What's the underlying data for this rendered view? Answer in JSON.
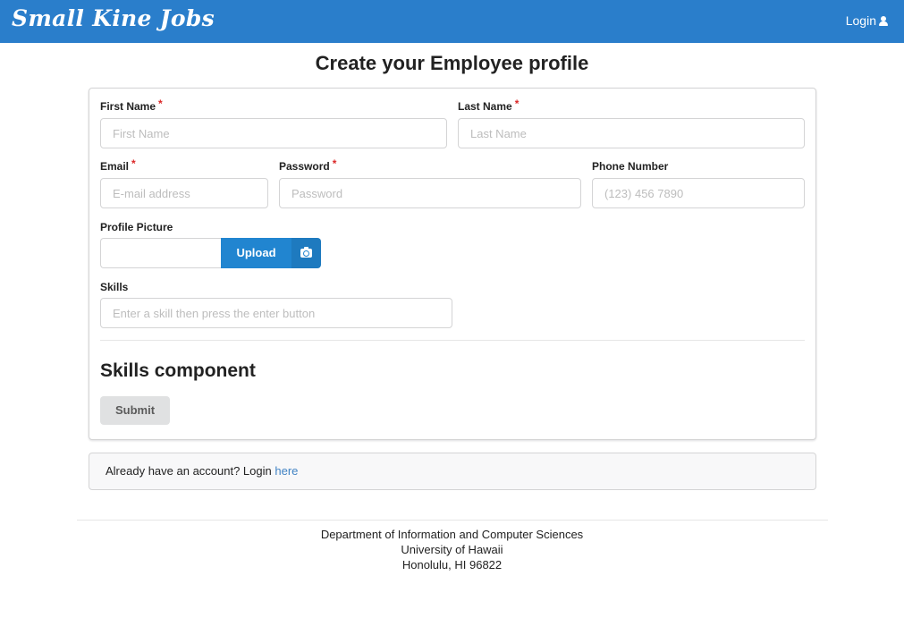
{
  "navbar": {
    "brand": "Small Kine Jobs",
    "login_label": "Login",
    "color": "#2a7ecb"
  },
  "page": {
    "title": "Create your Employee profile"
  },
  "form": {
    "first_name": {
      "label": "First Name",
      "required": "*",
      "placeholder": "First Name"
    },
    "last_name": {
      "label": "Last Name",
      "required": "*",
      "placeholder": "Last Name"
    },
    "email": {
      "label": "Email",
      "required": "*",
      "placeholder": "E-mail address"
    },
    "password": {
      "label": "Password",
      "required": "*",
      "placeholder": "Password"
    },
    "phone": {
      "label": "Phone Number",
      "placeholder": "(123) 456 7890"
    },
    "profile_picture": {
      "label": "Profile Picture",
      "upload_label": "Upload",
      "icon": "camera-icon"
    },
    "skills": {
      "label": "Skills",
      "placeholder": "Enter a skill then press the enter button"
    },
    "skills_heading": "Skills component",
    "submit_label": "Submit"
  },
  "login_prompt": {
    "text": "Already have an account? Login ",
    "link_label": "here"
  },
  "footer": {
    "line1": "Department of Information and Computer Sciences",
    "line2": "University of Hawaii",
    "line3": "Honolulu, HI 96822"
  }
}
